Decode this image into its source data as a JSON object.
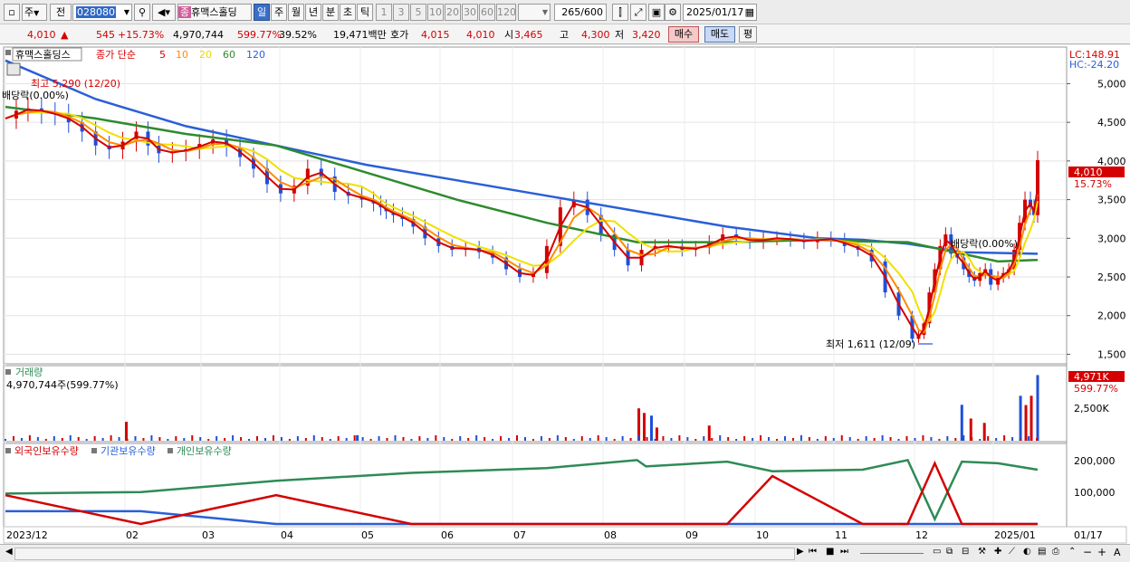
{
  "toolbar": {
    "dropdown_main": "주",
    "dropdown_prev": "전",
    "stock_code": "028080",
    "stock_name": "휴맥스홀딩",
    "stock_badge": "종",
    "periods": [
      "일",
      "주",
      "월",
      "년",
      "분",
      "초",
      "틱"
    ],
    "period_selected": "일",
    "intervals": [
      "1",
      "3",
      "5",
      "10",
      "20",
      "30",
      "60",
      "120"
    ],
    "count_value": "265",
    "count_total": "/600",
    "date": "2025/01/17"
  },
  "infobar": {
    "price": "4,010",
    "change_arrow": "▲",
    "change": "545",
    "change_pct": "+15.73%",
    "volume": "4,970,744",
    "volume_ratio": "599.77%",
    "turnover": "39.52%",
    "amount": "19,471백만",
    "ask_label": "호가",
    "ask_value": "4,015",
    "bid_value": "4,010",
    "open_label": "시",
    "open_value": "3,465",
    "high_label": "고",
    "high_value": "4,300",
    "low_label": "저",
    "low_value": "3,420",
    "buy_label": "매수",
    "sell_label": "매도",
    "eval_label": "평"
  },
  "price_panel": {
    "name_tag": "휴맥스홀딩스",
    "legend_type": "종가 단순",
    "ma_labels": [
      {
        "label": "5",
        "color": "#d40000"
      },
      {
        "label": "10",
        "color": "#ff8c00"
      },
      {
        "label": "20",
        "color": "#e8d800"
      },
      {
        "label": "60",
        "color": "#2e8b2e"
      },
      {
        "label": "120",
        "color": "#2a5fd8"
      }
    ],
    "lc_label": "LC:148.91",
    "hc_label": "HC:-24.20",
    "y_ticks": [
      "5,000",
      "4,500",
      "4,000",
      "3,500",
      "3,000",
      "2,500",
      "2,000",
      "1,500"
    ],
    "current_price_tag": "4,010",
    "current_pct_tag": "15.73%",
    "annotation_high": "최고 5,290 (12/20)",
    "annotation_div1": "배당락(0.00%)",
    "annotation_div2": "배당락(0.00%)",
    "annotation_low": "최저 1,611 (12/09)"
  },
  "volume_panel": {
    "title": "거래량",
    "value_text": "4,970,744주(599.77%)",
    "y_tick": "2,500K",
    "current_tag": "4,971K",
    "current_pct": "599.77%"
  },
  "holding_panel": {
    "legend": [
      {
        "label": "외국인보유수량",
        "color": "#d40000"
      },
      {
        "label": "기관보유수량",
        "color": "#2a5fd8"
      },
      {
        "label": "개인보유수량",
        "color": "#2e8b57"
      }
    ],
    "y_ticks": [
      "200,000",
      "100,000"
    ]
  },
  "x_axis": {
    "labels": [
      "2023/12",
      "02",
      "03",
      "04",
      "05",
      "06",
      "07",
      "08",
      "09",
      "10",
      "11",
      "12",
      "2025/01"
    ],
    "corner_label": "01/17"
  },
  "colors": {
    "ma5": "#d40000",
    "ma10": "#ff8c00",
    "ma20": "#f0e000",
    "ma60": "#2e8b2e",
    "ma120": "#2a5fd8",
    "up": "#d40000",
    "down": "#1f4fd8"
  },
  "chart_data": {
    "type": "candlestick",
    "ylim": [
      1400,
      5450
    ],
    "price_series": {
      "name": "close",
      "x_days": [
        0,
        12,
        25,
        40,
        55,
        70,
        85,
        100,
        115,
        130,
        145,
        158,
        170,
        185,
        200,
        215,
        230,
        245,
        260,
        275,
        290,
        305,
        320,
        335,
        350,
        365,
        380,
        395,
        408,
        416,
        422,
        430,
        440,
        452,
        465,
        480,
        495,
        510,
        525,
        540,
        555,
        570,
        585,
        600,
        615,
        630,
        645,
        660,
        675,
        690,
        705,
        720,
        735,
        750,
        765,
        780,
        795,
        810,
        825,
        840,
        855,
        870,
        885,
        900,
        915,
        930,
        945,
        960,
        975,
        990,
        1005,
        1012,
        1018,
        1024,
        1030,
        1036,
        1042,
        1048,
        1055,
        1062,
        1068,
        1074,
        1080,
        1086,
        1092,
        1100,
        1106,
        1112,
        1118,
        1124,
        1130,
        1136,
        1140,
        1144
      ],
      "values": [
        4550,
        4650,
        4680,
        4620,
        4600,
        4500,
        4380,
        4200,
        4150,
        4250,
        4380,
        4200,
        4100,
        4120,
        4150,
        4220,
        4280,
        4180,
        4050,
        3900,
        3700,
        3580,
        3680,
        3900,
        3800,
        3600,
        3550,
        3500,
        3450,
        3400,
        3350,
        3300,
        3250,
        3150,
        3000,
        2900,
        2850,
        2880,
        2820,
        2750,
        2600,
        2500,
        2550,
        2900,
        3400,
        3500,
        3300,
        3050,
        2850,
        2650,
        2850,
        2900,
        2900,
        2850,
        2880,
        2950,
        3050,
        3000,
        2950,
        3000,
        3000,
        2980,
        2950,
        3000,
        2980,
        2900,
        2850,
        2700,
        2300,
        2000,
        1700,
        1750,
        1900,
        2300,
        2600,
        2900,
        3050,
        2800,
        2750,
        2600,
        2500,
        2450,
        2550,
        2600,
        2400,
        2500,
        2550,
        2600,
        2850,
        3200,
        3500,
        3400,
        3300,
        4010
      ]
    },
    "ma120": {
      "x_days": [
        0,
        100,
        200,
        300,
        400,
        500,
        600,
        700,
        800,
        900,
        950,
        1000,
        1060,
        1100,
        1144
      ],
      "values": [
        5300,
        4800,
        4450,
        4200,
        3950,
        3750,
        3550,
        3350,
        3150,
        3000,
        2980,
        2930,
        2820,
        2810,
        2800
      ]
    },
    "ma60": {
      "x_days": [
        0,
        100,
        200,
        300,
        400,
        500,
        600,
        700,
        800,
        900,
        950,
        1000,
        1060,
        1100,
        1144
      ],
      "values": [
        4700,
        4550,
        4350,
        4200,
        3850,
        3500,
        3200,
        2950,
        2950,
        2980,
        2960,
        2950,
        2800,
        2700,
        2720
      ]
    },
    "volume_thousands": {
      "x_days": [
        134,
        390,
        702,
        708,
        716,
        722,
        780,
        1060,
        1070,
        1085,
        1125,
        1131,
        1137,
        1144
      ],
      "values": [
        1430,
        420,
        2450,
        2100,
        1900,
        1000,
        1150,
        2720,
        1680,
        1350,
        3400,
        2700,
        3400,
        4971
      ]
    },
    "holding": {
      "x_days": [
        0,
        150,
        300,
        450,
        600,
        700,
        710,
        800,
        850,
        950,
        1000,
        1030,
        1060,
        1100,
        1144
      ],
      "personal": [
        95000,
        100000,
        135000,
        160000,
        175000,
        200000,
        180000,
        195000,
        165000,
        170000,
        200000,
        15000,
        195000,
        190000,
        170000
      ],
      "institution": [
        40000,
        40000,
        0,
        0,
        0,
        0,
        0,
        0,
        0,
        0,
        0,
        0,
        0,
        0,
        0
      ],
      "foreign": [
        90000,
        0,
        90000,
        0,
        0,
        0,
        0,
        0,
        150000,
        0,
        0,
        190000,
        0,
        0,
        0
      ]
    }
  }
}
